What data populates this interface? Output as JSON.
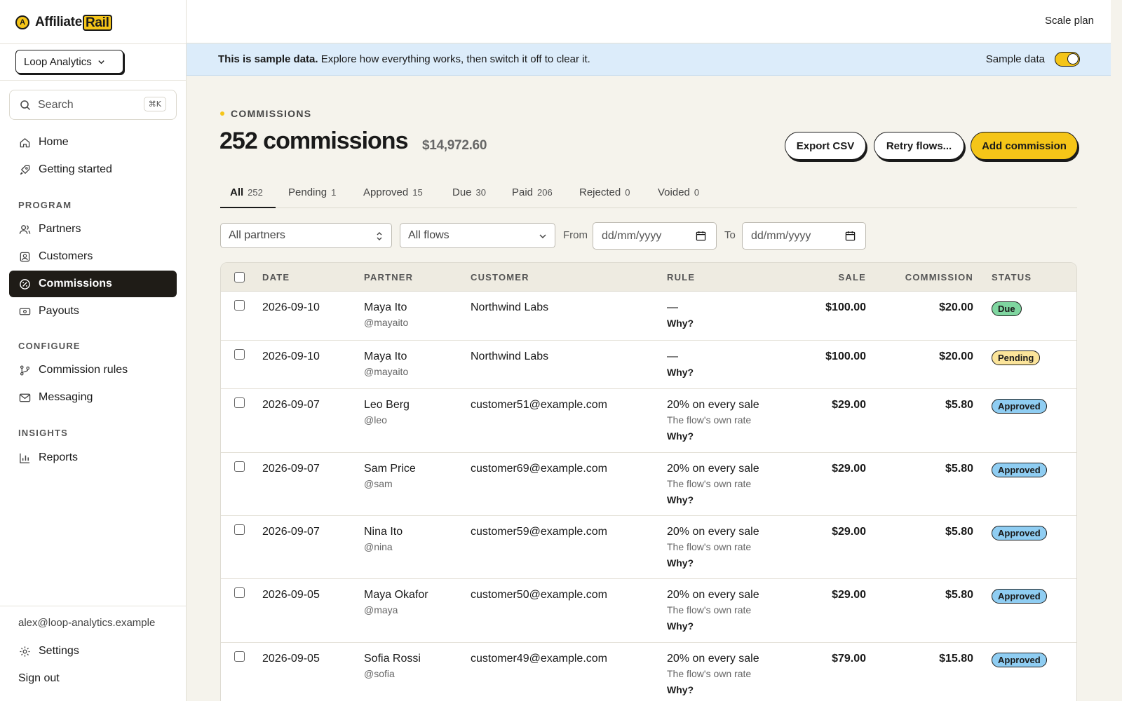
{
  "brand": {
    "name_prefix": "Affiliate",
    "name_highlight": "Rail",
    "mark_letter": "A"
  },
  "org": {
    "selected": "Loop Analytics"
  },
  "search": {
    "placeholder": "Search",
    "shortcut": "⌘K"
  },
  "nav": {
    "top": [
      {
        "label": "Home",
        "icon": "home-icon"
      },
      {
        "label": "Getting started",
        "icon": "rocket-icon"
      }
    ],
    "program_title": "PROGRAM",
    "program": [
      {
        "label": "Partners",
        "icon": "users-icon"
      },
      {
        "label": "Customers",
        "icon": "contact-icon"
      },
      {
        "label": "Commissions",
        "icon": "commission-icon",
        "active": true
      },
      {
        "label": "Payouts",
        "icon": "banknote-icon"
      }
    ],
    "configure_title": "CONFIGURE",
    "configure": [
      {
        "label": "Commission rules",
        "icon": "branch-icon"
      },
      {
        "label": "Messaging",
        "icon": "mail-icon"
      }
    ],
    "insights_title": "INSIGHTS",
    "insights": [
      {
        "label": "Reports",
        "icon": "bar-chart-icon"
      }
    ]
  },
  "account": {
    "email": "alex@loop-analytics.example",
    "settings_label": "Settings",
    "signout_label": "Sign out"
  },
  "topbar": {
    "plan": "Scale plan"
  },
  "banner": {
    "bold": "This is sample data.",
    "text": " Explore how everything works, then switch it off to clear it.",
    "toggle_label": "Sample data",
    "toggle_on": true
  },
  "page": {
    "eyebrow": "COMMISSIONS",
    "title": "252 commissions",
    "total": "$14,972.60"
  },
  "actions": {
    "export": "Export CSV",
    "retry": "Retry flows...",
    "add": "Add commission"
  },
  "tabs": [
    {
      "label": "All",
      "count": "252",
      "active": true
    },
    {
      "label": "Pending",
      "count": "1"
    },
    {
      "label": "Approved",
      "count": "15"
    },
    {
      "label": "Due",
      "count": "30"
    },
    {
      "label": "Paid",
      "count": "206"
    },
    {
      "label": "Rejected",
      "count": "0"
    },
    {
      "label": "Voided",
      "count": "0"
    }
  ],
  "filters": {
    "partners": "All partners",
    "flows": "All flows",
    "from_label": "From",
    "to_label": "To",
    "date_placeholder": "dd/mm/yyyy"
  },
  "table": {
    "headers": {
      "date": "DATE",
      "partner": "PARTNER",
      "customer": "CUSTOMER",
      "rule": "RULE",
      "sale": "SALE",
      "commission": "COMMISSION",
      "status": "STATUS"
    },
    "why_label": "Why?",
    "rows": [
      {
        "date": "2026-09-10",
        "partner": "Maya Ito",
        "handle": "@mayaito",
        "customer": "Northwind Labs",
        "rule": "—",
        "rule_sub": "",
        "sale": "$100.00",
        "commission": "$20.00",
        "status": "Due"
      },
      {
        "date": "2026-09-10",
        "partner": "Maya Ito",
        "handle": "@mayaito",
        "customer": "Northwind Labs",
        "rule": "—",
        "rule_sub": "",
        "sale": "$100.00",
        "commission": "$20.00",
        "status": "Pending"
      },
      {
        "date": "2026-09-07",
        "partner": "Leo Berg",
        "handle": "@leo",
        "customer": "customer51@example.com",
        "rule": "20% on every sale",
        "rule_sub": "The flow's own rate",
        "sale": "$29.00",
        "commission": "$5.80",
        "status": "Approved"
      },
      {
        "date": "2026-09-07",
        "partner": "Sam Price",
        "handle": "@sam",
        "customer": "customer69@example.com",
        "rule": "20% on every sale",
        "rule_sub": "The flow's own rate",
        "sale": "$29.00",
        "commission": "$5.80",
        "status": "Approved"
      },
      {
        "date": "2026-09-07",
        "partner": "Nina Ito",
        "handle": "@nina",
        "customer": "customer59@example.com",
        "rule": "20% on every sale",
        "rule_sub": "The flow's own rate",
        "sale": "$29.00",
        "commission": "$5.80",
        "status": "Approved"
      },
      {
        "date": "2026-09-05",
        "partner": "Maya Okafor",
        "handle": "@maya",
        "customer": "customer50@example.com",
        "rule": "20% on every sale",
        "rule_sub": "The flow's own rate",
        "sale": "$29.00",
        "commission": "$5.80",
        "status": "Approved"
      },
      {
        "date": "2026-09-05",
        "partner": "Sofia Rossi",
        "handle": "@sofia",
        "customer": "customer49@example.com",
        "rule": "20% on every sale",
        "rule_sub": "The flow's own rate",
        "sale": "$79.00",
        "commission": "$15.80",
        "status": "Approved"
      }
    ]
  },
  "status_colors": {
    "Due": "#7fd6a0",
    "Pending": "#fbe49a",
    "Approved": "#8fcdf2"
  },
  "accent_color": "#f5c518"
}
